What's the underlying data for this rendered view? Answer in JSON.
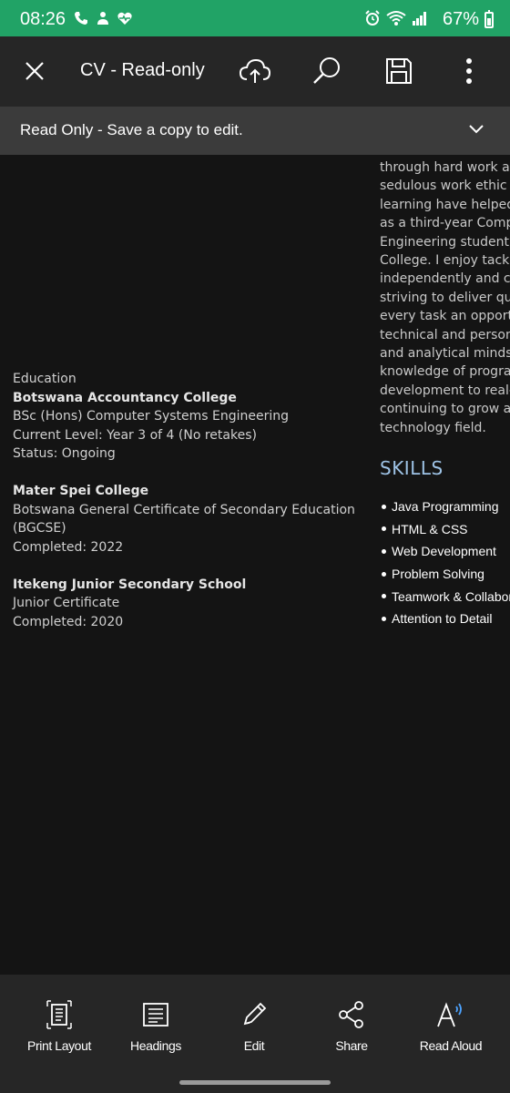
{
  "status_bar": {
    "time": "08:26",
    "battery": "67%",
    "left_icons": [
      "phone-icon",
      "usb-icon",
      "health-icon"
    ],
    "right_icons": [
      "alarm-icon",
      "wifi-icon",
      "signal-icon",
      "battery-icon"
    ],
    "color": "#21a366"
  },
  "toolbar": {
    "title": "CV - Read-only",
    "icons": [
      "close-icon",
      "cloud-upload-icon",
      "search-icon",
      "save-icon",
      "more-icon"
    ]
  },
  "readonly_bar": {
    "message": "Read Only - Save a copy to edit.",
    "icon": "chevron-down-icon"
  },
  "document": {
    "education_label": "Education",
    "schools": [
      {
        "name": "Botswana Accountancy College",
        "lines": [
          "BSc (Hons) Computer Systems Engineering",
          "Current Level: Year 3 of 4 (No retakes)",
          "Status: Ongoing"
        ]
      },
      {
        "name": "Mater Spei College",
        "lines": [
          "Botswana General Certificate of Secondary Education",
          "(BGCSE)",
          "Completed: 2022"
        ]
      },
      {
        "name": "Itekeng Junior Secondary School",
        "lines": [
          "Junior Certificate",
          "Completed: 2020"
        ]
      }
    ],
    "profile_lines": [
      "through hard work ar",
      "sedulous work ethic a",
      "learning have helped",
      "as a third-year Comp",
      "Engineering student a",
      "College. I enjoy tackli",
      "independently and co",
      "striving to deliver qua",
      "every task an opportu",
      "technical and persona",
      "and analytical mindse",
      "knowledge of progran",
      "development to real-",
      "continuing to grow as",
      "technology field."
    ],
    "skills_heading": "SKILLS",
    "skills": [
      "Java Programming",
      "HTML & CSS",
      "Web Development",
      "Problem Solving",
      "Teamwork & Collabor",
      "Attention to Detail"
    ],
    "skills_heading_color": "#9ec3e6"
  },
  "bottom_bar": {
    "items": [
      {
        "label": "Print Layout",
        "icon": "print-layout-icon"
      },
      {
        "label": "Headings",
        "icon": "headings-icon"
      },
      {
        "label": "Edit",
        "icon": "pencil-icon"
      },
      {
        "label": "Share",
        "icon": "share-icon"
      },
      {
        "label": "Read Aloud",
        "icon": "read-aloud-icon"
      }
    ]
  }
}
